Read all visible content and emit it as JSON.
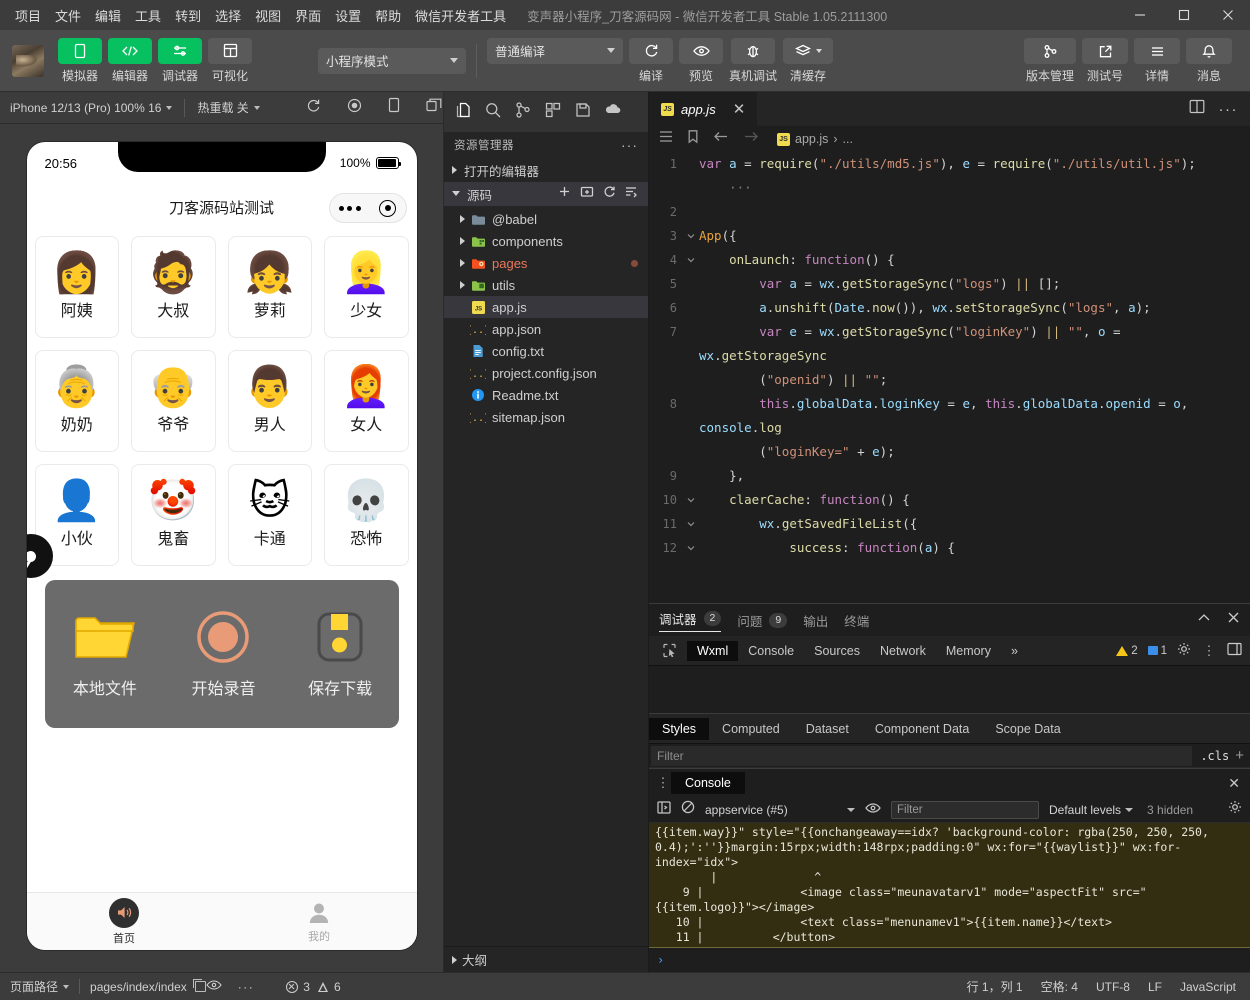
{
  "titlebar": {
    "menus": [
      "项目",
      "文件",
      "编辑",
      "工具",
      "转到",
      "选择",
      "视图",
      "界面",
      "设置",
      "帮助",
      "微信开发者工具"
    ],
    "window_title": "变声器小程序_刀客源码网 - 微信开发者工具 Stable 1.05.2111300"
  },
  "toolbar": {
    "left_buttons": [
      {
        "label": "模拟器",
        "icon": "phone-icon",
        "active": true
      },
      {
        "label": "编辑器",
        "icon": "code-icon",
        "active": true
      },
      {
        "label": "调试器",
        "icon": "sliders-icon",
        "active": true
      },
      {
        "label": "可视化",
        "icon": "layout-icon",
        "active": false
      }
    ],
    "mode_select": "小程序模式",
    "compile_select": "普通编译",
    "mid_buttons": [
      {
        "label": "编译",
        "icon": "refresh-icon"
      },
      {
        "label": "预览",
        "icon": "eye-icon"
      },
      {
        "label": "真机调试",
        "icon": "bug-icon"
      },
      {
        "label": "清缓存",
        "icon": "layers-icon"
      }
    ],
    "right_buttons": [
      {
        "label": "版本管理",
        "icon": "branch-icon"
      },
      {
        "label": "测试号",
        "icon": "external-link-icon"
      },
      {
        "label": "详情",
        "icon": "menu-icon"
      },
      {
        "label": "消息",
        "icon": "bell-icon"
      }
    ]
  },
  "simulator": {
    "device_select": "iPhone 12/13 (Pro) 100% 16",
    "hotreload_select": "热重载 关",
    "icons": [
      "refresh-icon",
      "record-icon",
      "rotate-device-icon",
      "multi-window-icon"
    ],
    "phone": {
      "status_time": "20:56",
      "battery_text": "100%",
      "nav_title": "刀客源码站测试",
      "voices": [
        {
          "name": "阿姨",
          "emoji": "👩"
        },
        {
          "name": "大叔",
          "emoji": "🧔"
        },
        {
          "name": "萝莉",
          "emoji": "👧"
        },
        {
          "name": "少女",
          "emoji": "👱‍♀️"
        },
        {
          "name": "奶奶",
          "emoji": "👵"
        },
        {
          "name": "爷爷",
          "emoji": "👴"
        },
        {
          "name": "男人",
          "emoji": "👨"
        },
        {
          "name": "女人",
          "emoji": "👩‍🦰"
        },
        {
          "name": "小伙",
          "emoji": "👤"
        },
        {
          "name": "鬼畜",
          "emoji": "🤡"
        },
        {
          "name": "卡通",
          "emoji": "🐱"
        },
        {
          "name": "恐怖",
          "emoji": "💀"
        }
      ],
      "actions": [
        {
          "label": "本地文件",
          "icon": "folder-icon"
        },
        {
          "label": "开始录音",
          "icon": "record-circle-icon"
        },
        {
          "label": "保存下载",
          "icon": "save-icon"
        }
      ],
      "tabs": [
        {
          "label": "首页",
          "icon": "speaker-icon",
          "active": true
        },
        {
          "label": "我的",
          "icon": "person-icon",
          "active": false
        }
      ]
    }
  },
  "explorer": {
    "activity_icons": [
      "files-icon",
      "search-icon",
      "source-control-icon",
      "extensions-icon",
      "save-all-icon",
      "cloud-icon"
    ],
    "title": "资源管理器",
    "more": "···",
    "open_editors": "打开的编辑器",
    "source_section": "源码",
    "section_actions": [
      "new-file-icon",
      "new-folder-icon",
      "refresh-icon",
      "collapse-all-icon"
    ],
    "tree": [
      {
        "name": "@babel",
        "type": "folder",
        "icon": "folder-plain-icon",
        "indent": 1
      },
      {
        "name": "components",
        "type": "folder",
        "icon": "folder-components-icon",
        "indent": 1
      },
      {
        "name": "pages",
        "type": "folder",
        "icon": "folder-pages-icon",
        "indent": 1,
        "modified": true
      },
      {
        "name": "utils",
        "type": "folder",
        "icon": "folder-utils-icon",
        "indent": 1
      },
      {
        "name": "app.js",
        "type": "file",
        "icon": "js-icon",
        "indent": 2,
        "selected": true
      },
      {
        "name": "app.json",
        "type": "file",
        "icon": "json-icon",
        "indent": 2
      },
      {
        "name": "config.txt",
        "type": "file",
        "icon": "text-icon",
        "indent": 2
      },
      {
        "name": "project.config.json",
        "type": "file",
        "icon": "json-icon",
        "indent": 2
      },
      {
        "name": "Readme.txt",
        "type": "file",
        "icon": "info-icon",
        "indent": 2
      },
      {
        "name": "sitemap.json",
        "type": "file",
        "icon": "json-icon",
        "indent": 2
      }
    ],
    "outline": "大纲"
  },
  "editor": {
    "tab_name": "app.js",
    "breadcrumb_file": "app.js",
    "breadcrumb_sep": "›",
    "breadcrumb_more": "...",
    "lines": [
      {
        "n": "1",
        "fold": "",
        "html": "<span class=\"kw\">var</span> <span class=\"id\">a</span> <span class=\"op\">=</span> <span class=\"fn\">require</span>(<span class=\"str\">\"./utils/md5.js\"</span>), <span class=\"id\">e</span> <span class=\"op\">=</span> <span class=\"fn\">require</span>(<span class=\"str\">\"./utils/util.js\"</span>);\n    <span class=\"ellip\">···</span>"
      },
      {
        "n": "2",
        "fold": "",
        "html": ""
      },
      {
        "n": "3",
        "fold": "v",
        "html": "<span class=\"ora\">App</span>({"
      },
      {
        "n": "4",
        "fold": "v",
        "html": "    <span class=\"yel\">onLaunch</span>: <span class=\"kw\">function</span>() {"
      },
      {
        "n": "5",
        "fold": "",
        "html": "        <span class=\"kw\">var</span> <span class=\"id\">a</span> <span class=\"op\">=</span> <span class=\"id\">wx</span>.<span class=\"fn\">getStorageSync</span>(<span class=\"str\">\"logs\"</span>) <span class=\"org\">||</span> [];"
      },
      {
        "n": "6",
        "fold": "",
        "html": "        <span class=\"id\">a</span>.<span class=\"fn\">unshift</span>(<span class=\"id\">Date</span>.<span class=\"fn\">now</span>()), <span class=\"id\">wx</span>.<span class=\"fn\">setStorageSync</span>(<span class=\"str\">\"logs\"</span>, <span class=\"id\">a</span>);"
      },
      {
        "n": "7",
        "fold": "",
        "html": "        <span class=\"kw\">var</span> <span class=\"id\">e</span> <span class=\"op\">=</span> <span class=\"id\">wx</span>.<span class=\"fn\">getStorageSync</span>(<span class=\"str\">\"loginKey\"</span>) <span class=\"org\">||</span> <span class=\"str\">\"\"</span>, <span class=\"id\">o</span> <span class=\"op\">=</span> <span class=\"id\">wx</span>.<span class=\"fn\">getStorageSync</span>\n        (<span class=\"str\">\"openid\"</span>) <span class=\"org\">||</span> <span class=\"str\">\"\"</span>;"
      },
      {
        "n": "8",
        "fold": "",
        "html": "        <span class=\"kw\">this</span>.<span class=\"id\">globalData</span>.<span class=\"id\">loginKey</span> <span class=\"op\">=</span> <span class=\"id\">e</span>, <span class=\"kw\">this</span>.<span class=\"id\">globalData</span>.<span class=\"id\">openid</span> <span class=\"op\">=</span> <span class=\"id\">o</span>, <span class=\"id\">console</span>.<span class=\"fn\">log</span>\n        (<span class=\"str\">\"loginKey=\"</span> <span class=\"op\">+</span> <span class=\"id\">e</span>);"
      },
      {
        "n": "9",
        "fold": "",
        "html": "    },"
      },
      {
        "n": "10",
        "fold": "v",
        "html": "    <span class=\"yel\">claerCache</span>: <span class=\"kw\">function</span>() {"
      },
      {
        "n": "11",
        "fold": "v",
        "html": "        <span class=\"id\">wx</span>.<span class=\"fn\">getSavedFileList</span>({"
      },
      {
        "n": "12",
        "fold": "v",
        "html": "            <span class=\"yel\">success</span>: <span class=\"kw\">function</span>(<span class=\"id\">a</span>) {"
      }
    ]
  },
  "debugger": {
    "panel_tabs": [
      {
        "label": "调试器",
        "count": "2",
        "active": true
      },
      {
        "label": "问题",
        "count": "9",
        "active": false
      },
      {
        "label": "输出",
        "count": "",
        "active": false
      },
      {
        "label": "终端",
        "count": "",
        "active": false
      }
    ],
    "devtools_tabs": [
      "Wxml",
      "Console",
      "Sources",
      "Network",
      "Memory"
    ],
    "devtools_active": "Wxml",
    "overflow": "»",
    "warn_count": "2",
    "msg_count": "1",
    "style_tabs": [
      "Styles",
      "Computed",
      "Dataset",
      "Component Data",
      "Scope Data"
    ],
    "style_active": "Styles",
    "filter_placeholder": "Filter",
    "cls_label": ".cls",
    "plus": "+"
  },
  "console": {
    "tab": "Console",
    "context": "appservice (#5)",
    "filter_placeholder": "Filter",
    "levels": "Default levels",
    "hidden": "3 hidden",
    "output": "{{item.way}}\" style=\"{{onchangeaway==idx? 'background-color: rgba(250, 250, 250,\n0.4);':''}}margin:15rpx;width:148rpx;padding:0\" wx:for=\"{{waylist}}\" wx:for-\nindex=\"idx\">\n        |              ^\n    9 |              <image class=\"meunavatarv1\" mode=\"aspectFit\" src=\"\n{{item.logo}}\"></image>\n   10 |              <text class=\"menunamev1\">{{item.name}}</text>\n   11 |          </button>",
    "prompt": "›"
  },
  "status": {
    "page_path_label": "页面路径",
    "page_path": "pages/index/index",
    "error_count": "3",
    "warn_count": "6",
    "cursor": "行 1，列 1",
    "spaces": "空格: 4",
    "encoding": "UTF-8",
    "eol": "LF",
    "language": "JavaScript"
  }
}
